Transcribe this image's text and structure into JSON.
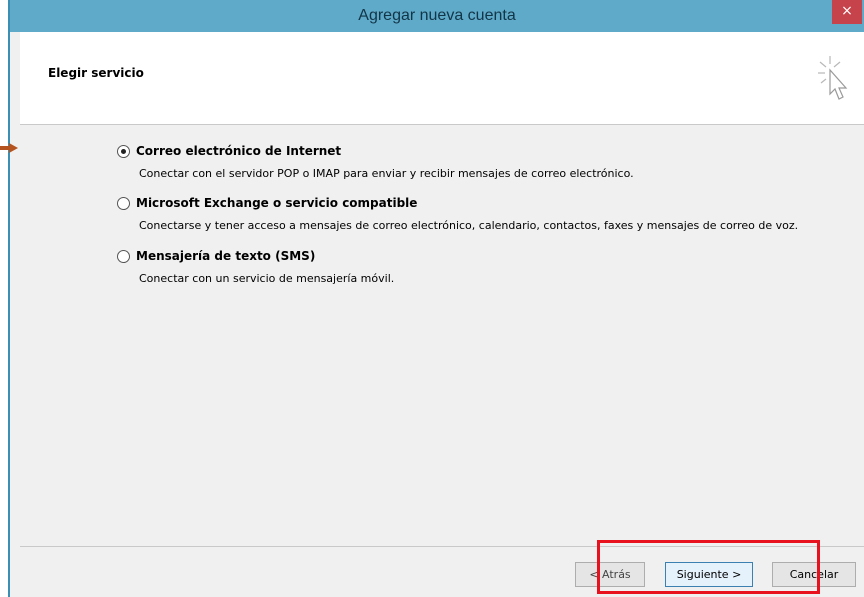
{
  "window": {
    "title": "Agregar nueva cuenta",
    "close_symbol": "×"
  },
  "header": {
    "title": "Elegir servicio"
  },
  "options": [
    {
      "label": "Correo electrónico de Internet",
      "description": "Conectar con el servidor POP o IMAP para enviar y recibir mensajes de correo electrónico.",
      "selected": true
    },
    {
      "label": "Microsoft Exchange o servicio compatible",
      "description": "Conectarse y tener acceso a mensajes de correo electrónico, calendario, contactos, faxes y mensajes de correo de voz.",
      "selected": false
    },
    {
      "label": "Mensajería de texto (SMS)",
      "description": "Conectar con un servicio de mensajería móvil.",
      "selected": false
    }
  ],
  "buttons": {
    "back": "< Atrás",
    "next": "Siguiente >",
    "cancel": "Cancelar"
  },
  "colors": {
    "titlebar": "#5faac9",
    "close": "#c7434b",
    "highlight": "#e8121e",
    "arrow": "#b5541f"
  }
}
